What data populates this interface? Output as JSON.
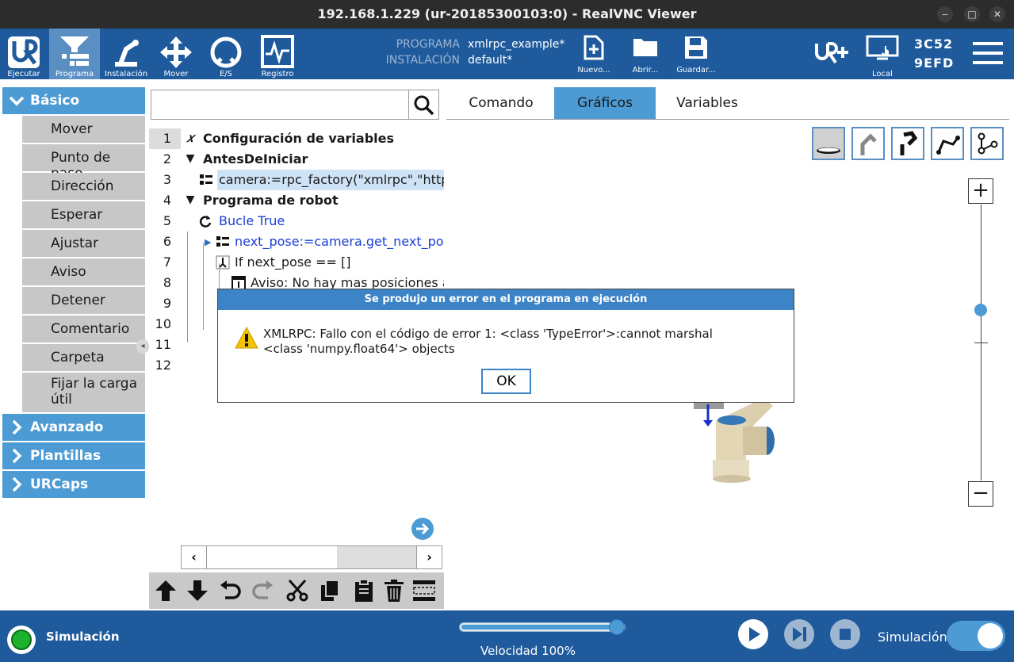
{
  "window": {
    "title": "192.168.1.229 (ur-20185300103:0) - RealVNC Viewer",
    "minimize": "‒",
    "maximize": "□",
    "close": "✕"
  },
  "toolbar": {
    "items": [
      {
        "label": "Ejecutar",
        "icon": "ur-logo-icon"
      },
      {
        "label": "Programa",
        "icon": "program-icon"
      },
      {
        "label": "Instalación",
        "icon": "robot-arm-icon"
      },
      {
        "label": "Mover",
        "icon": "move-arrows-icon"
      },
      {
        "label": "E/S",
        "icon": "io-icon"
      },
      {
        "label": "Registro",
        "icon": "log-icon"
      }
    ],
    "program_label": "PROGRAMA",
    "program_value": "xmlrpc_example*",
    "install_label": "INSTALACIÓN",
    "install_value": "default*",
    "file_buttons": [
      {
        "label": "Nuevo...",
        "icon": "new-file-icon"
      },
      {
        "label": "Abrir...",
        "icon": "open-folder-icon"
      },
      {
        "label": "Guardar...",
        "icon": "save-icon"
      }
    ],
    "local_label": "Local",
    "serial_line1": "3C52",
    "serial_line2": "9EFD"
  },
  "sidebar": {
    "basic": "Básico",
    "basic_items": [
      "Mover",
      "Punto de paso",
      "Dirección",
      "Esperar",
      "Ajustar",
      "Aviso",
      "Detener",
      "Comentario",
      "Carpeta",
      "Fijar la carga",
      "útil"
    ],
    "advanced": "Avanzado",
    "templates": "Plantillas",
    "urcaps": "URCaps"
  },
  "tree": {
    "search_placeholder": "",
    "lines": [
      {
        "num": "1",
        "text": "Configuración de variables"
      },
      {
        "num": "2",
        "text": "AntesDeIniciar"
      },
      {
        "num": "3",
        "text": "camera:=rpc_factory(\"xmlrpc\",\"http:"
      },
      {
        "num": "4",
        "text": "Programa de robot"
      },
      {
        "num": "5",
        "text": "Bucle  True"
      },
      {
        "num": "6",
        "text": "next_pose:=camera.get_next_pos"
      },
      {
        "num": "7",
        "text": "If next_pose == []"
      },
      {
        "num": "8",
        "text": "Aviso: No hay mas posiciones a"
      },
      {
        "num": "9",
        "text": ""
      },
      {
        "num": "10",
        "text": ""
      },
      {
        "num": "11",
        "text": ""
      },
      {
        "num": "12",
        "text": ""
      }
    ]
  },
  "tabs": [
    "Comando",
    "Gráficos",
    "Variables"
  ],
  "zoom": {
    "in": "+",
    "out": "−",
    "level": 0.2
  },
  "status": {
    "mode": "Simulación",
    "speed": "Velocidad 100%",
    "speed_value": 100,
    "sim_toggle_label": "Simulación",
    "sim_on": true
  },
  "dialog": {
    "title": "Se produjo un error en el programa en ejecución",
    "message_line1": "XMLRPC: Fallo con el código de error 1: <class 'TypeError'>:cannot marshal",
    "message_line2": "<class 'numpy.float64'> objects",
    "ok": "OK"
  },
  "colors": {
    "toolbar": "#1e5a9c",
    "accent": "#4d9bd4",
    "dialog_title": "#3c84c6",
    "status_green": "#1cb22e"
  }
}
